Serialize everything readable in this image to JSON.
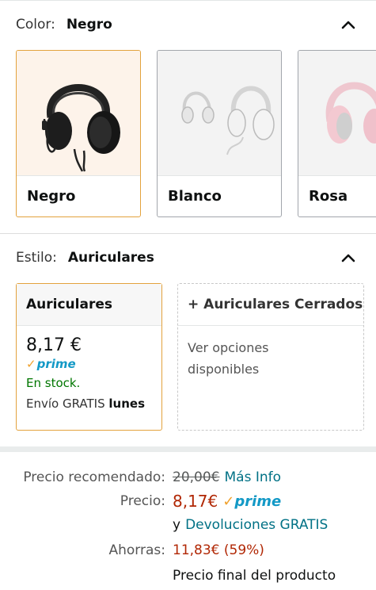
{
  "color_section": {
    "label": "Color:",
    "value": "Negro",
    "swatches": [
      {
        "name": "Negro",
        "selected": true
      },
      {
        "name": "Blanco",
        "selected": false
      },
      {
        "name": "Rosa",
        "selected": false
      }
    ]
  },
  "style_section": {
    "label": "Estilo:",
    "value": "Auriculares",
    "options": [
      {
        "title": "Auriculares",
        "price": "8,17 €",
        "prime": "prime",
        "stock": "En stock.",
        "shipping_prefix": "Envío GRATIS",
        "shipping_day": "lunes"
      },
      {
        "title": "+ Auriculares Cerrados",
        "body": "Ver opciones disponibles"
      }
    ]
  },
  "pricing": {
    "recommended_label": "Precio recomendado:",
    "recommended_value": "20,00€",
    "more_info": "Más Info",
    "price_label": "Precio:",
    "price_value": "8,17€",
    "prime": "prime",
    "returns_prefix": "y",
    "returns_link": "Devoluciones GRATIS",
    "savings_label": "Ahorras:",
    "savings_value": "11,83€ (59%)",
    "final_price_note": "Precio final del producto"
  },
  "colors": {
    "selected_border": "#e3a23d",
    "link": "#007185",
    "price_red": "#b12704",
    "stock_green": "#007600",
    "prime_blue": "#1399c6"
  }
}
